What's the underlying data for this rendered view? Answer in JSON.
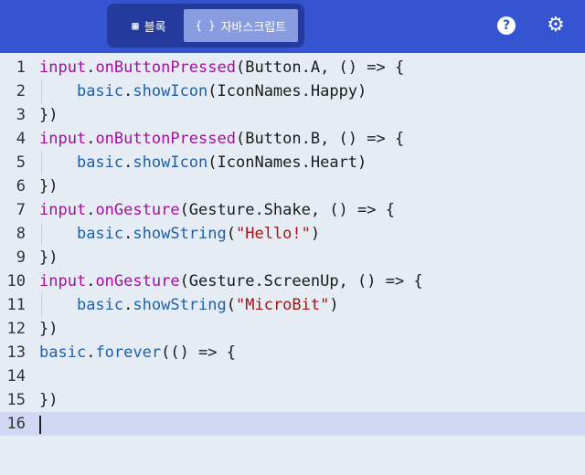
{
  "toolbar": {
    "blocks_label": "블록",
    "js_label": "자바스크립트",
    "blocks_icon": "puzzle-icon",
    "js_icon_text": "{ }",
    "help_icon": "help-icon",
    "gear_icon": "gear-icon"
  },
  "colors": {
    "topbar": "#3454d1",
    "toggle_bg": "#243a9c",
    "active_segment": "#8a9ce0",
    "editor_bg": "#e6ecf3",
    "current_line": "#d0d8f3",
    "input_ns": "#a1119f",
    "basic_ns": "#1e5fa8",
    "string": "#a31515"
  },
  "editor": {
    "lines": [
      {
        "num": "1",
        "parts": [
          {
            "t": "input",
            "c": "kw"
          },
          {
            "t": ".",
            "c": ""
          },
          {
            "t": "onButtonPressed",
            "c": "kw"
          },
          {
            "t": "(Button.A, () => {",
            "c": ""
          }
        ]
      },
      {
        "num": "2",
        "parts": [
          {
            "t": "    ",
            "c": ""
          },
          {
            "t": "basic",
            "c": "basic"
          },
          {
            "t": ".",
            "c": ""
          },
          {
            "t": "showIcon",
            "c": "basic"
          },
          {
            "t": "(IconNames.Happy)",
            "c": ""
          }
        ]
      },
      {
        "num": "3",
        "parts": [
          {
            "t": "})",
            "c": ""
          }
        ]
      },
      {
        "num": "4",
        "parts": [
          {
            "t": "input",
            "c": "kw"
          },
          {
            "t": ".",
            "c": ""
          },
          {
            "t": "onButtonPressed",
            "c": "kw"
          },
          {
            "t": "(Button.B, () => {",
            "c": ""
          }
        ]
      },
      {
        "num": "5",
        "parts": [
          {
            "t": "    ",
            "c": ""
          },
          {
            "t": "basic",
            "c": "basic"
          },
          {
            "t": ".",
            "c": ""
          },
          {
            "t": "showIcon",
            "c": "basic"
          },
          {
            "t": "(IconNames.Heart)",
            "c": ""
          }
        ]
      },
      {
        "num": "6",
        "parts": [
          {
            "t": "})",
            "c": ""
          }
        ]
      },
      {
        "num": "7",
        "parts": [
          {
            "t": "input",
            "c": "kw"
          },
          {
            "t": ".",
            "c": ""
          },
          {
            "t": "onGesture",
            "c": "kw"
          },
          {
            "t": "(Gesture.Shake, () => {",
            "c": ""
          }
        ]
      },
      {
        "num": "8",
        "parts": [
          {
            "t": "    ",
            "c": ""
          },
          {
            "t": "basic",
            "c": "basic"
          },
          {
            "t": ".",
            "c": ""
          },
          {
            "t": "showString",
            "c": "basic"
          },
          {
            "t": "(",
            "c": ""
          },
          {
            "t": "\"Hello!\"",
            "c": "str"
          },
          {
            "t": ")",
            "c": ""
          }
        ]
      },
      {
        "num": "9",
        "parts": [
          {
            "t": "})",
            "c": ""
          }
        ]
      },
      {
        "num": "10",
        "parts": [
          {
            "t": "input",
            "c": "kw"
          },
          {
            "t": ".",
            "c": ""
          },
          {
            "t": "onGesture",
            "c": "kw"
          },
          {
            "t": "(Gesture.ScreenUp, () => {",
            "c": ""
          }
        ]
      },
      {
        "num": "11",
        "parts": [
          {
            "t": "    ",
            "c": ""
          },
          {
            "t": "basic",
            "c": "basic"
          },
          {
            "t": ".",
            "c": ""
          },
          {
            "t": "showString",
            "c": "basic"
          },
          {
            "t": "(",
            "c": ""
          },
          {
            "t": "\"MicroBit\"",
            "c": "str"
          },
          {
            "t": ")",
            "c": ""
          }
        ]
      },
      {
        "num": "12",
        "parts": [
          {
            "t": "})",
            "c": ""
          }
        ]
      },
      {
        "num": "13",
        "parts": [
          {
            "t": "basic",
            "c": "basic"
          },
          {
            "t": ".",
            "c": ""
          },
          {
            "t": "forever",
            "c": "basic"
          },
          {
            "t": "(() => {",
            "c": ""
          }
        ]
      },
      {
        "num": "14",
        "parts": []
      },
      {
        "num": "15",
        "parts": [
          {
            "t": "})",
            "c": ""
          }
        ]
      },
      {
        "num": "16",
        "parts": []
      }
    ],
    "current_line": "16"
  }
}
